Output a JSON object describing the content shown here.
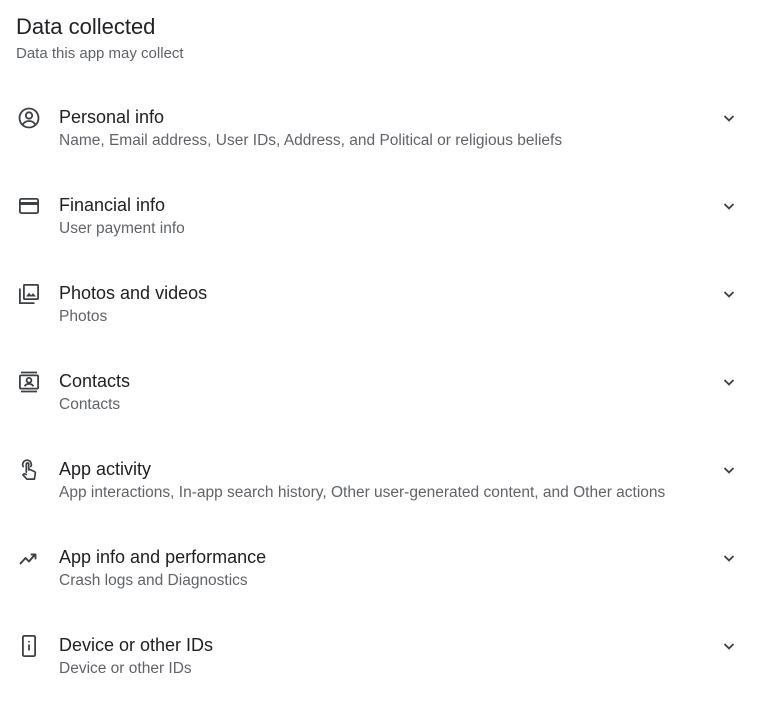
{
  "section": {
    "title": "Data collected",
    "subtitle": "Data this app may collect"
  },
  "items": [
    {
      "icon": "account-circle-icon",
      "title": "Personal info",
      "description": "Name, Email address, User IDs, Address, and Political or religious beliefs"
    },
    {
      "icon": "credit-card-icon",
      "title": "Financial info",
      "description": "User payment info"
    },
    {
      "icon": "photo-library-icon",
      "title": "Photos and videos",
      "description": "Photos"
    },
    {
      "icon": "contacts-icon",
      "title": "Contacts",
      "description": "Contacts"
    },
    {
      "icon": "touch-app-icon",
      "title": "App activity",
      "description": "App interactions, In-app search history, Other user-generated content, and Other actions"
    },
    {
      "icon": "trending-icon",
      "title": "App info and performance",
      "description": "Crash logs and Diagnostics"
    },
    {
      "icon": "device-info-icon",
      "title": "Device or other IDs",
      "description": "Device or other IDs"
    }
  ],
  "colors": {
    "text_primary": "#202124",
    "text_secondary": "#5f6368",
    "icon": "#3c4043"
  }
}
